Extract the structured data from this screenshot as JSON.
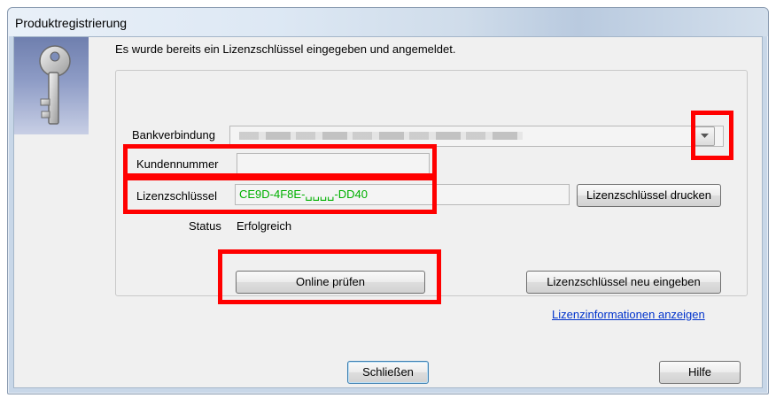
{
  "window": {
    "title": "Produktregistrierung"
  },
  "intro_text": "Es wurde bereits ein Lizenzschlüssel eingegeben und angemeldet.",
  "fields": {
    "bank_label": "Bankverbindung",
    "customer_label": "Kundennummer",
    "customer_value": "",
    "license_label": "Lizenzschlüssel",
    "license_value": "CE9D-4F8E-␣␣␣␣-DD40",
    "status_label": "Status",
    "status_value": "Erfolgreich"
  },
  "buttons": {
    "print_license": "Lizenzschlüssel drucken",
    "online_check": "Online prüfen",
    "reenter_license": "Lizenzschlüssel neu eingeben",
    "close": "Schließen",
    "help": "Hilfe"
  },
  "links": {
    "license_info": "Lizenzinformationen anzeigen"
  },
  "icons": {
    "key": "key-icon",
    "dropdown": "chevron-down-icon"
  },
  "colors": {
    "highlight": "#ff0000",
    "license_text": "#00b000",
    "link": "#0033cc"
  }
}
